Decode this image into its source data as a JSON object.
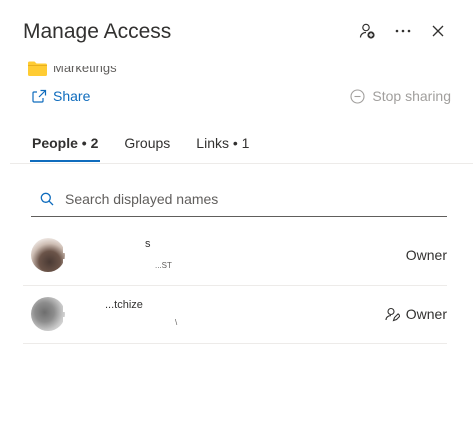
{
  "panel": {
    "title": "Manage Access"
  },
  "folder": {
    "label": "Marketings",
    "icon": "folder-icon",
    "color": "#ffcc33"
  },
  "actions": {
    "share_label": "Share",
    "stop_sharing_label": "Stop sharing"
  },
  "tabs": [
    {
      "label": "People • 2",
      "active": true
    },
    {
      "label": "Groups",
      "active": false
    },
    {
      "label": "Links • 1",
      "active": false
    }
  ],
  "search": {
    "placeholder": "Search displayed names"
  },
  "people": [
    {
      "name_fragment": "s",
      "email_fragment": "...ST",
      "role": "Owner"
    },
    {
      "name_fragment": "...tchize",
      "email_fragment": "\\",
      "role": "Owner"
    }
  ],
  "colors": {
    "accent": "#0f6cbd",
    "disabled": "#a19f9d"
  }
}
